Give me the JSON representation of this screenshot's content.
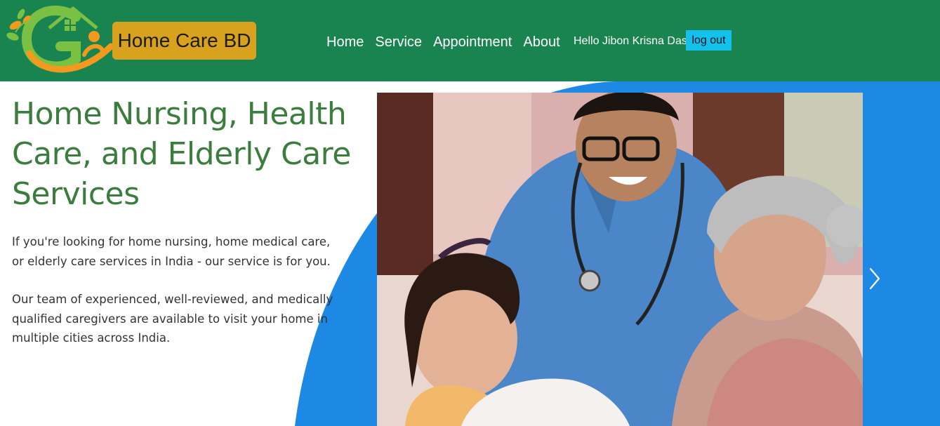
{
  "nav": {
    "brand": "Home Care BD",
    "links": [
      "Home",
      "Service",
      "Appointment",
      "About"
    ],
    "greeting": "Hello Jibon Krisna Das",
    "logout": "log out"
  },
  "hero": {
    "title": "Home Nursing, Health Care, and Elderly Care Services",
    "paragraph1": "If you're looking for home nursing, home medical care, or elderly care services in  India - our service is for you.",
    "paragraph2": "Our team of experienced, well-reviewed, and medically qualified caregivers are available to visit your home in multiple cities across  India."
  },
  "colors": {
    "navbar": "#1a8450",
    "brand_bg": "#d8a21e",
    "logout_bg": "#13c1ec",
    "hero_blue": "#1e88e5",
    "title_green": "#3b7d3d"
  },
  "icons": {
    "logo": "home-care-logo-icon",
    "next": "chevron-right-icon"
  }
}
